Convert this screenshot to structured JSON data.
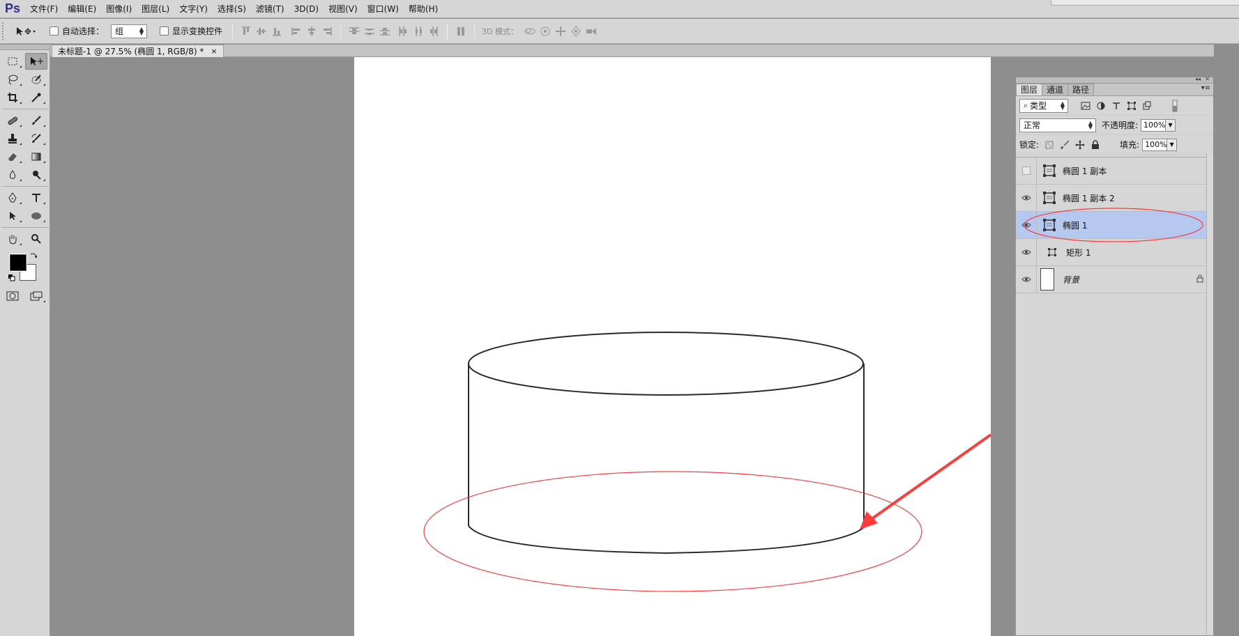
{
  "app": {
    "logo": "Ps"
  },
  "menu": [
    "文件(F)",
    "编辑(E)",
    "图像(I)",
    "图层(L)",
    "文字(Y)",
    "选择(S)",
    "滤镜(T)",
    "3D(D)",
    "视图(V)",
    "窗口(W)",
    "帮助(H)"
  ],
  "options": {
    "auto_select_label": "自动选择：",
    "auto_select_value": "组",
    "show_transform_label": "显示变换控件",
    "mode3d_label": "3D 模式："
  },
  "document": {
    "tab_title": "未标题-1 @ 27.5% (椭圆 1, RGB/8) *",
    "close": "×"
  },
  "colors": {
    "foreground": "#000000",
    "background": "#ffffff",
    "annotation": "#ff3b3b",
    "selection": "#b4c8f0"
  },
  "layers_panel": {
    "tabs": [
      "图层",
      "通道",
      "路径"
    ],
    "filter_kind": "类型",
    "blend_mode": "正常",
    "opacity_label": "不透明度:",
    "opacity_value": "100%",
    "lock_label": "锁定:",
    "fill_label": "填充:",
    "fill_value": "100%",
    "layers": [
      {
        "name": "椭圆 1 副本",
        "visible": false,
        "selected": false,
        "type": "shape"
      },
      {
        "name": "椭圆 1 副本 2",
        "visible": true,
        "selected": false,
        "type": "shape"
      },
      {
        "name": "椭圆 1",
        "visible": true,
        "selected": true,
        "type": "shape"
      },
      {
        "name": "矩形 1",
        "visible": true,
        "selected": false,
        "type": "shape-small"
      },
      {
        "name": "背景",
        "visible": true,
        "selected": false,
        "type": "background",
        "locked": true
      }
    ]
  },
  "icons": {
    "move_tool": "move-icon",
    "eye": "eye-icon",
    "lock": "lock-icon"
  }
}
